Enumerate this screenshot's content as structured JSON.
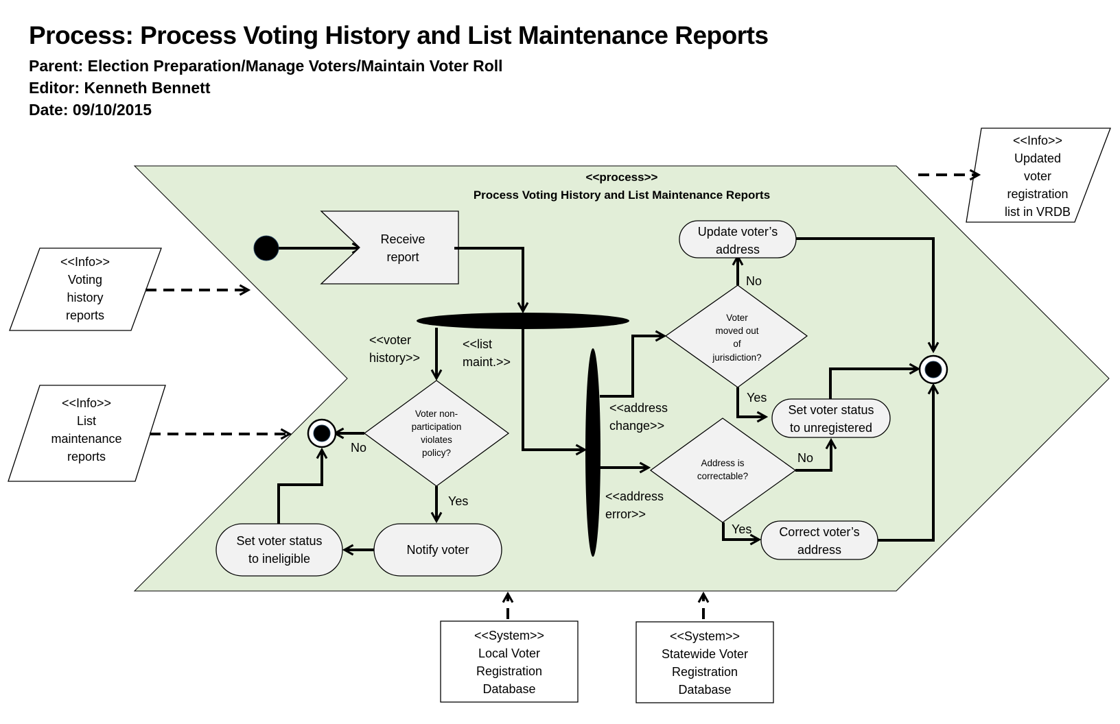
{
  "header": {
    "title": "Process: Process Voting History and List Maintenance Reports",
    "parent": "Parent: Election Preparation/Manage Voters/Maintain Voter Roll",
    "editor": "Editor: Kenneth Bennett",
    "date": "Date: 09/10/2015"
  },
  "colors": {
    "process_fill": "#e2eed8",
    "node_fill": "#f2f2f2",
    "line": "#000000"
  },
  "process": {
    "stereotype": "<<process>>",
    "name": "Process Voting History and List Maintenance Reports"
  },
  "inputs": [
    {
      "stereotype": "<<Info>>",
      "lines": [
        "Voting",
        "history",
        "reports"
      ]
    },
    {
      "stereotype": "<<Info>>",
      "lines": [
        "List",
        "maintenance",
        "reports"
      ]
    }
  ],
  "output": {
    "stereotype": "<<Info>>",
    "lines": [
      "Updated",
      "voter",
      "registration",
      "list in VRDB"
    ]
  },
  "systems": [
    {
      "stereotype": "<<System>>",
      "lines": [
        "Local Voter",
        "Registration",
        "Database"
      ]
    },
    {
      "stereotype": "<<System>>",
      "lines": [
        "Statewide Voter",
        "Registration",
        "Database"
      ]
    }
  ],
  "nodes": {
    "receive": [
      "Receive",
      "report"
    ],
    "decision_policy": [
      "Voter non-",
      "participation",
      "violates",
      "policy?"
    ],
    "notify": "Notify voter",
    "ineligible": [
      "Set voter status",
      "to ineligible"
    ],
    "decision_moved": [
      "Voter",
      "moved out",
      "of",
      "jurisdiction?"
    ],
    "update_address": [
      "Update voter’s",
      "address"
    ],
    "unregistered": [
      "Set voter status",
      "to unregistered"
    ],
    "decision_correctable": [
      "Address is",
      "correctable?"
    ],
    "correct_address": [
      "Correct voter’s",
      "address"
    ]
  },
  "guards": {
    "voter_history": [
      "<<voter",
      "history>>"
    ],
    "list_maint": [
      "<<list",
      "maint.>>"
    ],
    "address_change": [
      "<<address",
      "change>>"
    ],
    "address_error": [
      "<<address",
      "error>>"
    ],
    "policy_no": "No",
    "policy_yes": "Yes",
    "moved_no": "No",
    "moved_yes": "Yes",
    "correctable_no": "No",
    "correctable_yes": "Yes"
  }
}
